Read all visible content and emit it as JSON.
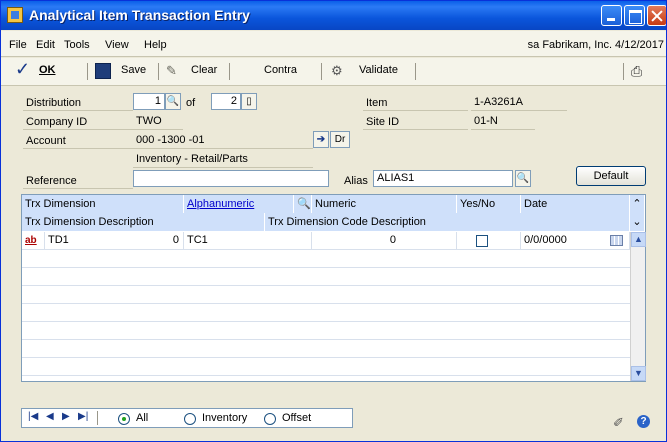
{
  "window": {
    "title": "Analytical Item Transaction Entry"
  },
  "menu": {
    "items": [
      "File",
      "Edit",
      "Tools",
      "View",
      "Help"
    ],
    "user_info": "sa  Fabrikam, Inc. 4/12/2017"
  },
  "toolbar": {
    "ok": "OK",
    "save": "Save",
    "clear": "Clear",
    "contra": "Contra",
    "validate": "Validate"
  },
  "form": {
    "distribution_label": "Distribution",
    "distribution_value": "1",
    "of_label": "of",
    "of_value": "2",
    "item_label": "Item",
    "item_value": "1-A3261A",
    "company_label": "Company ID",
    "company_value": "TWO",
    "site_label": "Site ID",
    "site_value": "01-N",
    "account_label": "Account",
    "account_value": "000 -1300 -01",
    "dr_label": "Dr",
    "account_desc": "Inventory - Retail/Parts",
    "reference_label": "Reference",
    "reference_value": "",
    "alias_label": "Alias",
    "alias_value": "ALIAS1",
    "default_button": "Default"
  },
  "grid": {
    "headers": {
      "trx_dimension": "Trx Dimension",
      "alphanumeric": "Alphanumeric",
      "numeric": "Numeric",
      "yes_no": "Yes/No",
      "date": "Date",
      "trx_dim_desc": "Trx Dimension Description",
      "trx_dim_code_desc": "Trx Dimension Code Description"
    },
    "rows": [
      {
        "dimension": "TD1",
        "value": "0",
        "alphanumeric": "TC1",
        "numeric": "0",
        "yes_no": false,
        "date": "0/0/0000"
      }
    ]
  },
  "footer": {
    "radio_all": "All",
    "radio_inventory": "Inventory",
    "radio_offset": "Offset",
    "selected": "All"
  }
}
